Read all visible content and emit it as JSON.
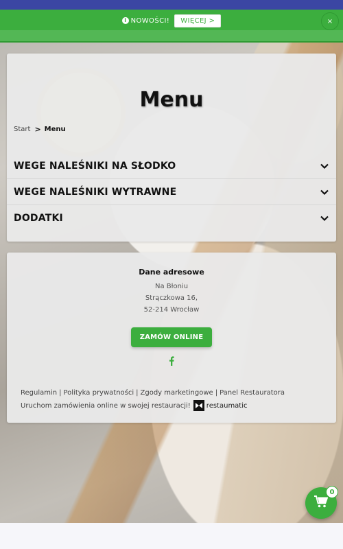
{
  "banner": {
    "news_label": "NOWOŚCI!",
    "more_label": "WIĘCEJ >",
    "close_label": "×"
  },
  "page": {
    "title": "Menu",
    "breadcrumb": {
      "home": "Start",
      "separator": ">",
      "current": "Menu"
    }
  },
  "categories": [
    {
      "label": "WEGE NALEŚNIKI NA SŁODKO"
    },
    {
      "label": "WEGE NALEŚNIKI WYTRAWNE"
    },
    {
      "label": "DODATKI"
    }
  ],
  "address": {
    "title": "Dane adresowe",
    "lines": [
      "Na Błoniu",
      "Strączkowa 16,",
      "52-214 Wrocław"
    ]
  },
  "order_button": "ZAMÓW ONLINE",
  "footer": {
    "links": [
      "Regulamin",
      "Polityka prywatności",
      "Zgody marketingowe",
      "Panel Restauratora"
    ],
    "promo_text": "Uruchom zamówienia online w swojej restauracji!",
    "brand": "restaumatic"
  },
  "cart": {
    "count": "0"
  },
  "icons": {
    "info": "info-icon",
    "chevron": "chevron-down-icon",
    "facebook": "facebook-icon",
    "cart": "shopping-cart-icon",
    "brand_logo": "restaumatic-logo-icon"
  },
  "colors": {
    "accent": "#3cae3e",
    "topbar": "#3b46a3"
  }
}
